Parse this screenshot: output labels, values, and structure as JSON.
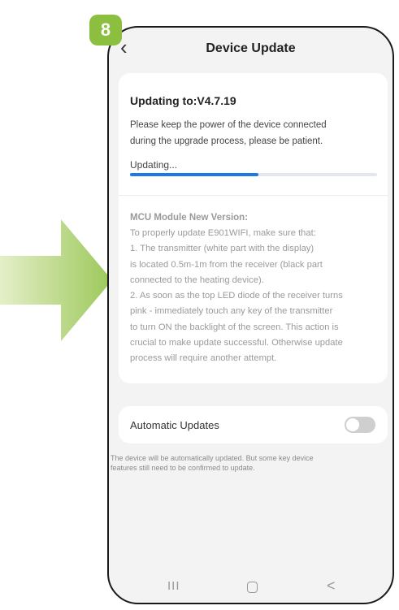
{
  "step": {
    "number": "8"
  },
  "colors": {
    "accent": "#8cbf3f",
    "progress": "#1f78e4"
  },
  "header": {
    "title": "Device Update",
    "back_icon": "chevron-left-icon"
  },
  "update": {
    "title": "Updating to:V4.7.19",
    "keep_power_lines": [
      "Please keep the power of the device connected",
      "during the upgrade process, please be patient."
    ],
    "progress_label": "Updating...",
    "progress_fraction": 0.52
  },
  "mcu": {
    "title": "MCU Module New Version:",
    "lines": [
      "To properly update E901WIFI, make sure that:",
      "1. The transmitter (white part with the display)",
      "is located 0.5m-1m from the receiver (black part",
      "connected to the heating device).",
      "2. As soon as the top LED diode of the receiver turns",
      "pink - immediately touch any key of the transmitter",
      "to turn ON the backlight of the screen. This action is",
      "crucial to make update successful. Otherwise update",
      "process will require another attempt."
    ]
  },
  "auto_update": {
    "label": "Automatic Updates",
    "enabled": false,
    "note_lines": [
      "The device will be automatically updated. But some key device",
      "features still need to be confirmed to update."
    ]
  },
  "navbar": {
    "recent": "III",
    "home_icon": "home-icon",
    "back": "<"
  }
}
